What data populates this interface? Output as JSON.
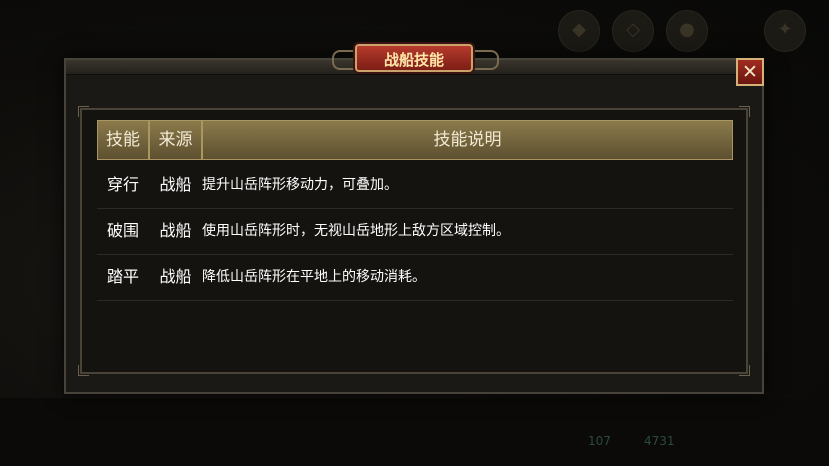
{
  "dialog": {
    "title": "战船技能",
    "close_label": "✕"
  },
  "table": {
    "headers": [
      "技能",
      "来源",
      "技能说明"
    ],
    "rows": [
      {
        "skill": "穿行",
        "source": "战船",
        "desc": "提升山岳阵形移动力，可叠加。"
      },
      {
        "skill": "破围",
        "source": "战船",
        "desc": "使用山岳阵形时，无视山岳地形上敌方区域控制。"
      },
      {
        "skill": "踏平",
        "source": "战船",
        "desc": "降低山岳阵形在平地上的移动消耗。"
      }
    ]
  },
  "background": {
    "counter_a": "107",
    "counter_b": "4731"
  },
  "colors": {
    "title_red": "#b63a2c",
    "header_gold": "#8b7a4b",
    "border_gold": "#c9a36a"
  }
}
